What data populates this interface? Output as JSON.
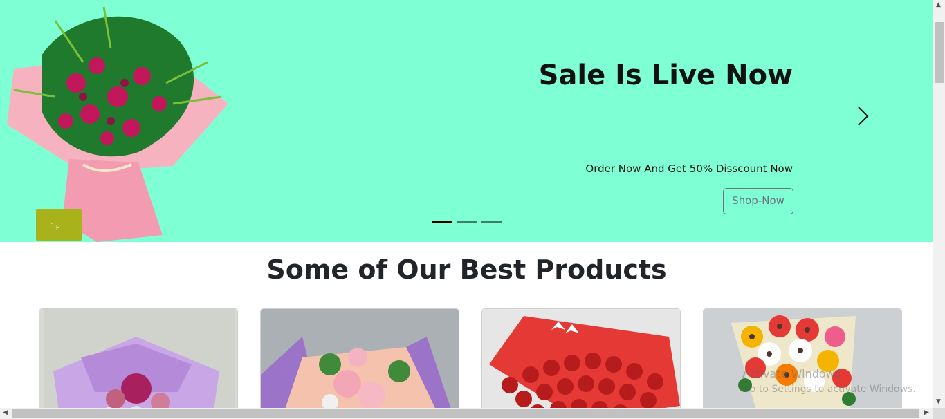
{
  "hero": {
    "title": "Sale Is Live Now",
    "subtitle": "Order Now And Get 50% Disscount Now",
    "button_label": "Shop-Now",
    "gift_tag_text": "fnp",
    "indicators": [
      {
        "active": true
      },
      {
        "active": false
      },
      {
        "active": false
      }
    ],
    "background_color": "#7fffd4"
  },
  "products": {
    "title": "Some of Our Best Products",
    "cards": [
      {
        "image": "pink-lily-purple-bouquet"
      },
      {
        "image": "pink-rose-bouquet"
      },
      {
        "image": "red-rose-bouquet"
      },
      {
        "image": "gerbera-bouquet"
      }
    ]
  },
  "os_watermark": {
    "line1": "Activate Windows",
    "line2": "Go to Settings to activate Windows."
  },
  "icons": {
    "next": "chevron-right-icon",
    "scroll_up": "triangle-up-icon",
    "scroll_down": "triangle-down-icon",
    "scroll_left": "triangle-left-icon",
    "scroll_right": "triangle-right-icon"
  }
}
